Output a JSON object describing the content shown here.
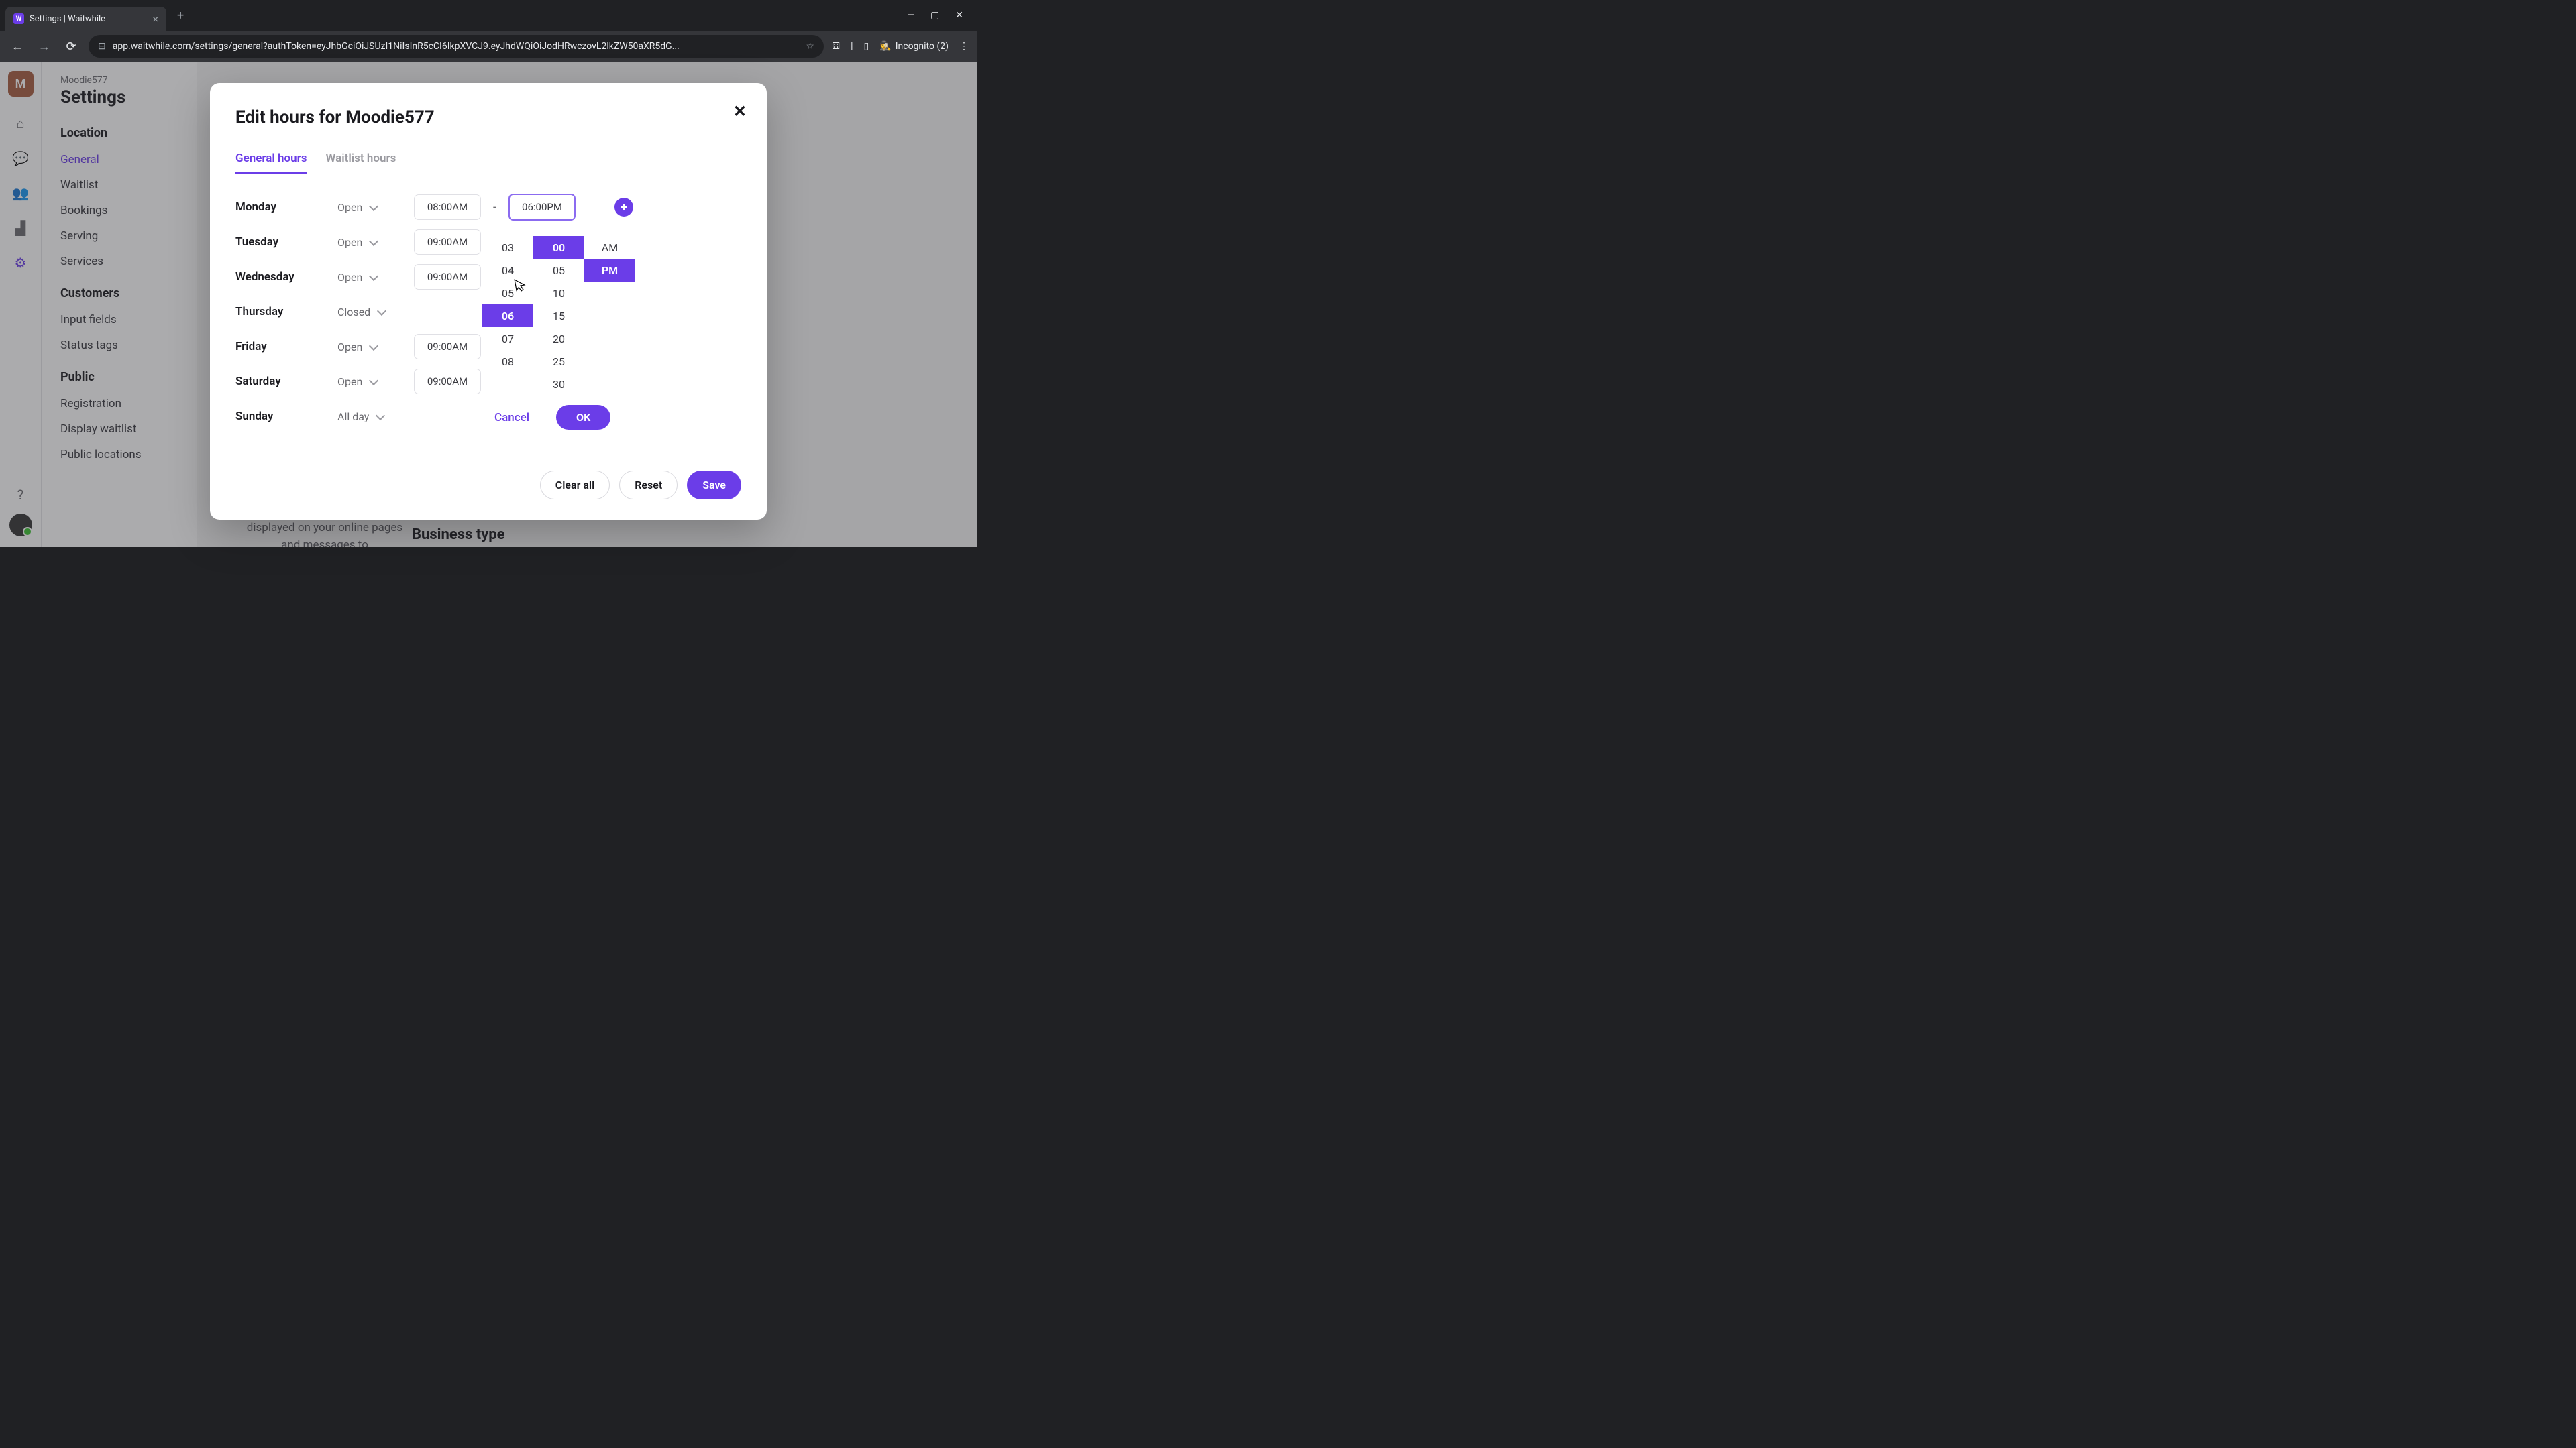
{
  "browser": {
    "tab_title": "Settings | Waitwhile",
    "url": "app.waitwhile.com/settings/general?authToken=eyJhbGciOiJSUzI1NiIsInR5cCI6IkpXVCJ9.eyJhdWQiOiJodHRwczovL2lkZW50aXR5dG...",
    "incognito_label": "Incognito (2)"
  },
  "app": {
    "avatar_initial": "M",
    "breadcrumb": "Moodie577",
    "page_title": "Settings",
    "nav": {
      "section1_title": "Location",
      "items1": [
        "General",
        "Waitlist",
        "Bookings",
        "Serving",
        "Services"
      ],
      "section2_title": "Customers",
      "items2": [
        "Input fields",
        "Status tags"
      ],
      "section3_title": "Public",
      "items3": [
        "Registration",
        "Display waitlist",
        "Public locations"
      ]
    },
    "bg_text": "displayed on your online pages and messages to",
    "bg_heading": "Business type"
  },
  "modal": {
    "title": "Edit hours for Moodie577",
    "tabs": {
      "general": "General hours",
      "waitlist": "Waitlist hours"
    },
    "days": [
      {
        "day": "Monday",
        "status": "Open",
        "open_time": "08:00AM",
        "close_time": "06:00PM",
        "close_active": true,
        "has_add": true
      },
      {
        "day": "Tuesday",
        "status": "Open",
        "open_time": "09:00AM"
      },
      {
        "day": "Wednesday",
        "status": "Open",
        "open_time": "09:00AM"
      },
      {
        "day": "Thursday",
        "status": "Closed"
      },
      {
        "day": "Friday",
        "status": "Open",
        "open_time": "09:00AM"
      },
      {
        "day": "Saturday",
        "status": "Open",
        "open_time": "09:00AM"
      },
      {
        "day": "Sunday",
        "status": "All day"
      }
    ],
    "picker": {
      "hours": [
        "03",
        "04",
        "05",
        "06",
        "07",
        "08"
      ],
      "hour_selected": "06",
      "minutes": [
        "00",
        "05",
        "10",
        "15",
        "20",
        "25",
        "30"
      ],
      "minute_selected": "00",
      "ampm": [
        "AM",
        "PM"
      ],
      "ampm_selected": "PM",
      "cancel": "Cancel",
      "ok": "OK"
    },
    "footer": {
      "clear": "Clear all",
      "reset": "Reset",
      "save": "Save"
    }
  }
}
